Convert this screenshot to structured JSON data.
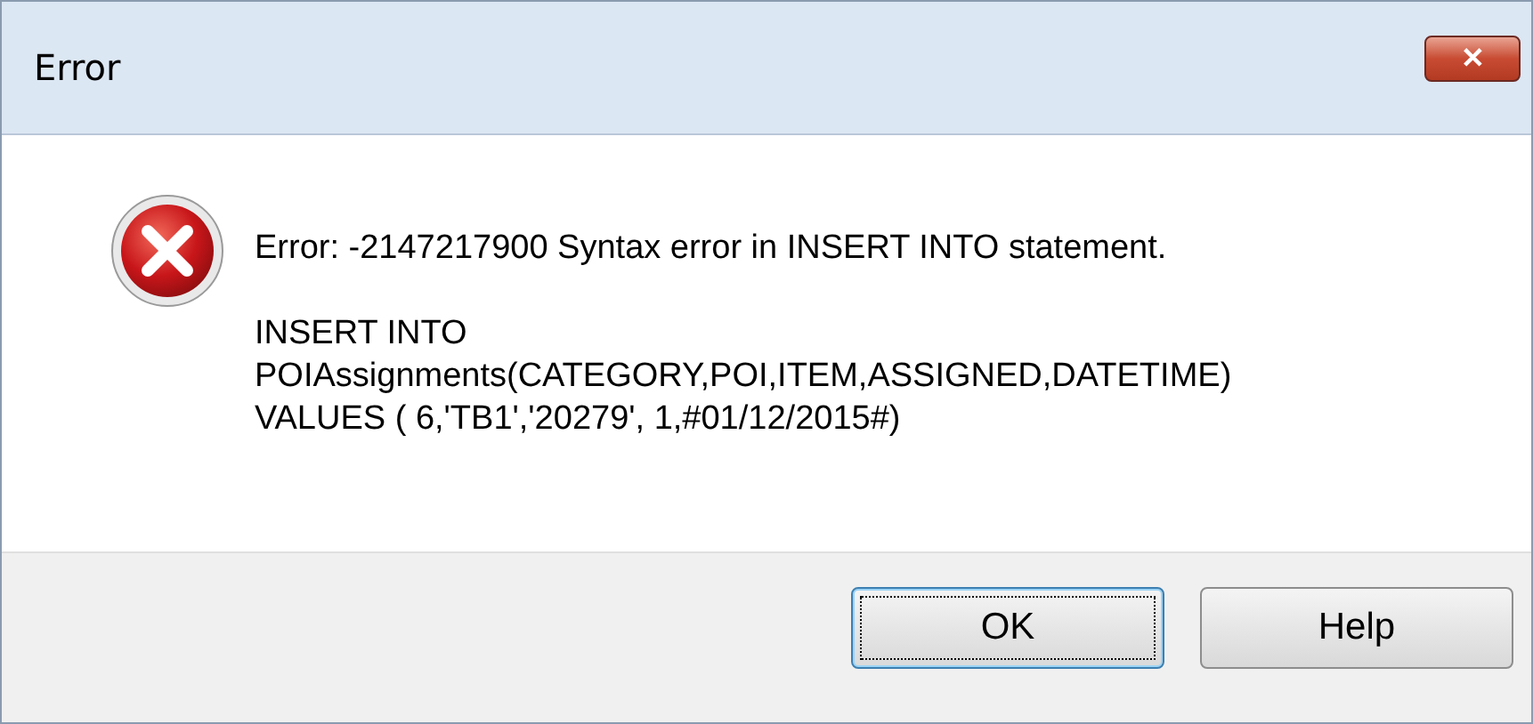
{
  "window": {
    "title": "Error",
    "close_symbol": "✕"
  },
  "message": {
    "headline": "Error: -2147217900 Syntax error in INSERT INTO statement.",
    "lines": [
      "INSERT INTO",
      "POIAssignments(CATEGORY,POI,ITEM,ASSIGNED,DATETIME)",
      "VALUES ( 6,'TB1','20279', 1,#01/12/2015#)"
    ]
  },
  "buttons": [
    {
      "label": "OK",
      "selected": true
    },
    {
      "label": "Help",
      "selected": false
    }
  ]
}
